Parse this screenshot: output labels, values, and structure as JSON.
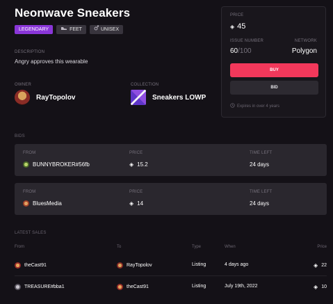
{
  "item": {
    "title": "Neonwave Sneakers",
    "tags": [
      {
        "label": "LEGENDARY",
        "icon": "none"
      },
      {
        "label": "FEET",
        "icon": "shoe-icon"
      },
      {
        "label": "UNISEX",
        "icon": "unisex-icon"
      }
    ],
    "description_label": "DESCRIPTION",
    "description": "Angry approves this wearable",
    "owner_label": "OWNER",
    "owner": "RayTopolov",
    "collection_label": "COLLECTION",
    "collection": "Sneakers LOWP"
  },
  "panel": {
    "price_label": "PRICE",
    "price": "45",
    "issue_label": "ISSUE NUMBER",
    "issue_current": "60",
    "issue_total": "/100",
    "network_label": "NETWORK",
    "network": "Polygon",
    "buy_label": "BUY",
    "bid_label": "BID",
    "expires": "Expires in over 4 years"
  },
  "bids": {
    "section_label": "BIDS",
    "headers": {
      "from": "FROM",
      "price": "PRICE",
      "time": "TIME LEFT"
    },
    "rows": [
      {
        "from": "BUNNYBROKER#56fb",
        "price": "15.2",
        "time": "24 days"
      },
      {
        "from": "BluesMedia",
        "price": "14",
        "time": "24 days"
      }
    ]
  },
  "sales": {
    "section_label": "LATEST SALES",
    "headers": {
      "from": "From",
      "to": "To",
      "type": "Type",
      "when": "When",
      "price": "Price"
    },
    "rows": [
      {
        "from": "theCast91",
        "to": "RayTopolov",
        "type": "Listing",
        "when": "4 days ago",
        "price": "22"
      },
      {
        "from": "TREASURE#bba1",
        "to": "theCast91",
        "type": "Listing",
        "when": "July 19th, 2022",
        "price": "10"
      }
    ]
  },
  "colors": {
    "background": "#141117",
    "accent_buy": "#f2385b",
    "legendary": "#8a36d8"
  }
}
